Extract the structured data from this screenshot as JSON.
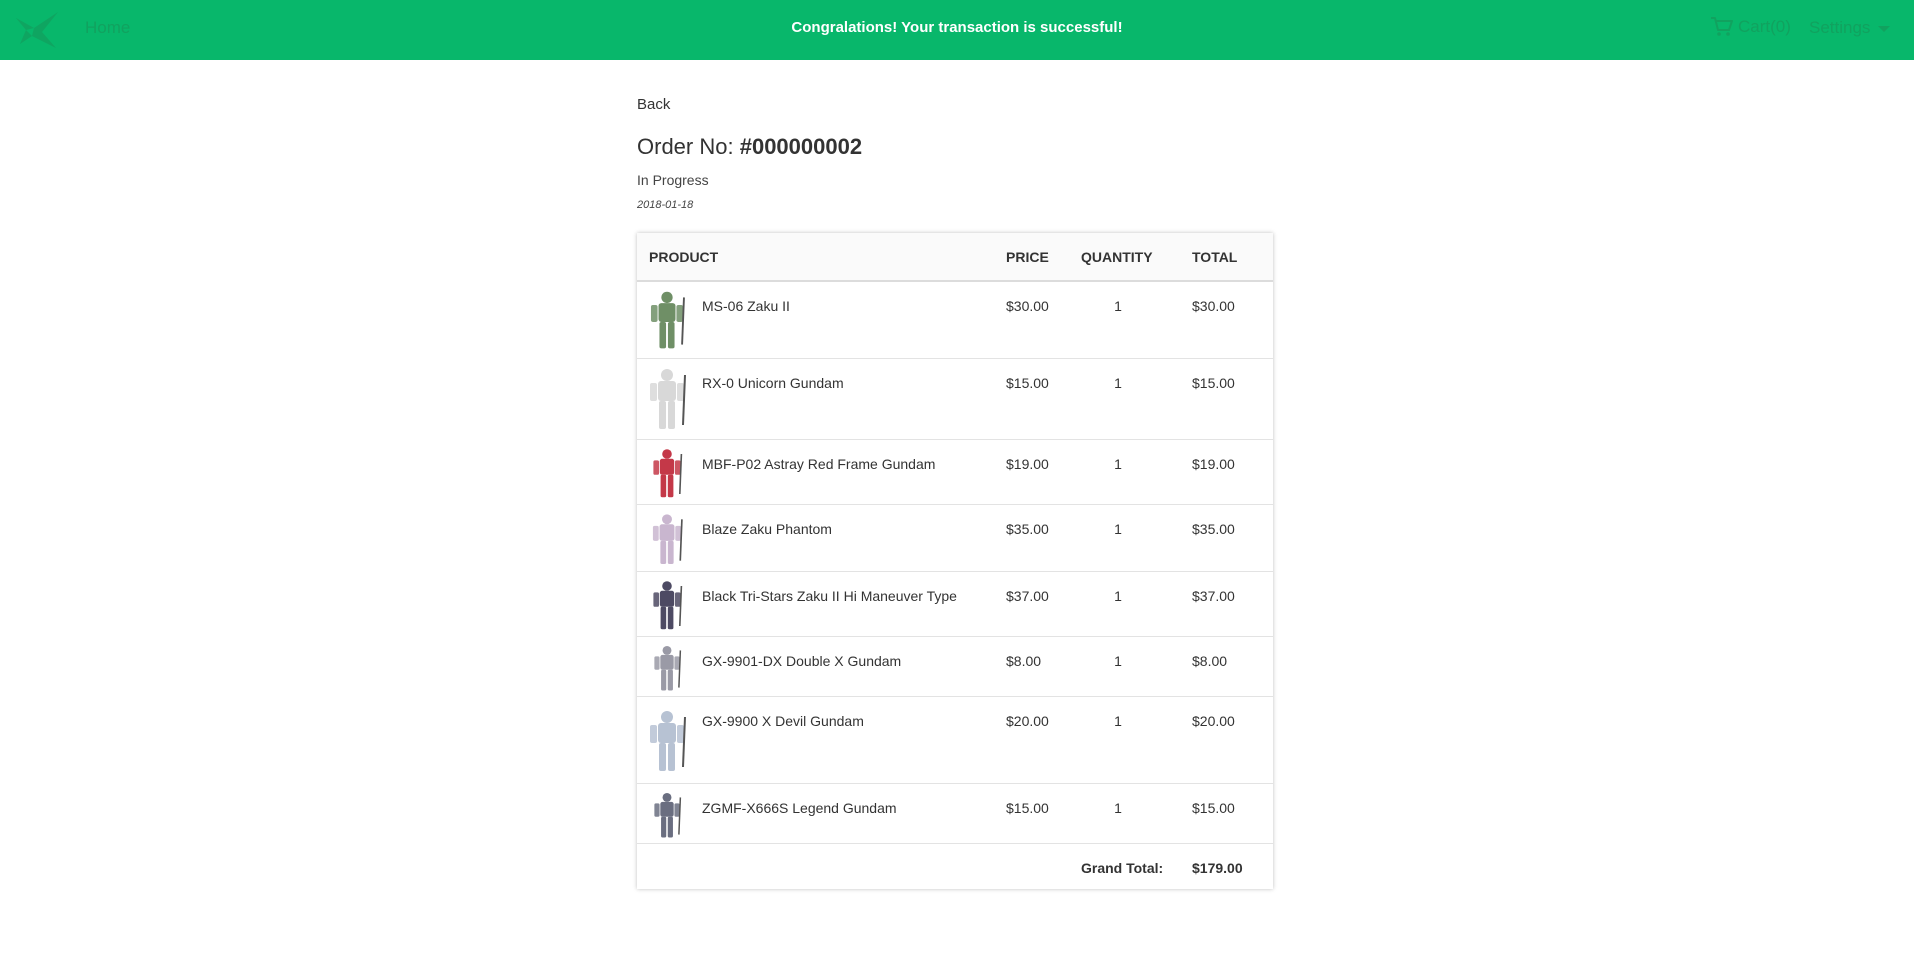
{
  "nav": {
    "home_label": "Home",
    "flash_message": "Congralations! Your transaction is successful!",
    "cart_label": "Cart(0)",
    "cart_icon": "cart-icon",
    "settings_label": "Settings",
    "logo_icon": "gundam-logo"
  },
  "colors": {
    "topbar": "#08b76b",
    "nav_text": "#11a25f"
  },
  "order": {
    "back_label": "Back",
    "number_prefix": "Order No:",
    "number": "#000000002",
    "status": "In Progress",
    "date": "2018-01-18"
  },
  "table": {
    "headers": {
      "product": "PRODUCT",
      "price": "PRICE",
      "quantity": "QUANTITY",
      "total": "TOTAL"
    },
    "items": [
      {
        "name": "MS-06 Zaku II",
        "price": "$30.00",
        "quantity": "1",
        "total": "$30.00",
        "color": "#6f8f66"
      },
      {
        "name": "RX-0 Unicorn Gundam",
        "price": "$15.00",
        "quantity": "1",
        "total": "$15.00",
        "color": "#d8d8d8"
      },
      {
        "name": "MBF-P02 Astray Red Frame Gundam",
        "price": "$19.00",
        "quantity": "1",
        "total": "$19.00",
        "color": "#c43848"
      },
      {
        "name": "Blaze Zaku Phantom",
        "price": "$35.00",
        "quantity": "1",
        "total": "$35.00",
        "color": "#c9b6cf"
      },
      {
        "name": "Black Tri-Stars Zaku II Hi Maneuver Type",
        "price": "$37.00",
        "quantity": "1",
        "total": "$37.00",
        "color": "#4d4a63"
      },
      {
        "name": "GX-9901-DX Double X Gundam",
        "price": "$8.00",
        "quantity": "1",
        "total": "$8.00",
        "color": "#9a9aa6"
      },
      {
        "name": "GX-9900 X Devil Gundam",
        "price": "$20.00",
        "quantity": "1",
        "total": "$20.00",
        "color": "#b7c2d3"
      },
      {
        "name": "ZGMF-X666S Legend Gundam",
        "price": "$15.00",
        "quantity": "1",
        "total": "$15.00",
        "color": "#6a6e80"
      }
    ],
    "grand_total_label": "Grand Total:",
    "grand_total": "$179.00"
  }
}
